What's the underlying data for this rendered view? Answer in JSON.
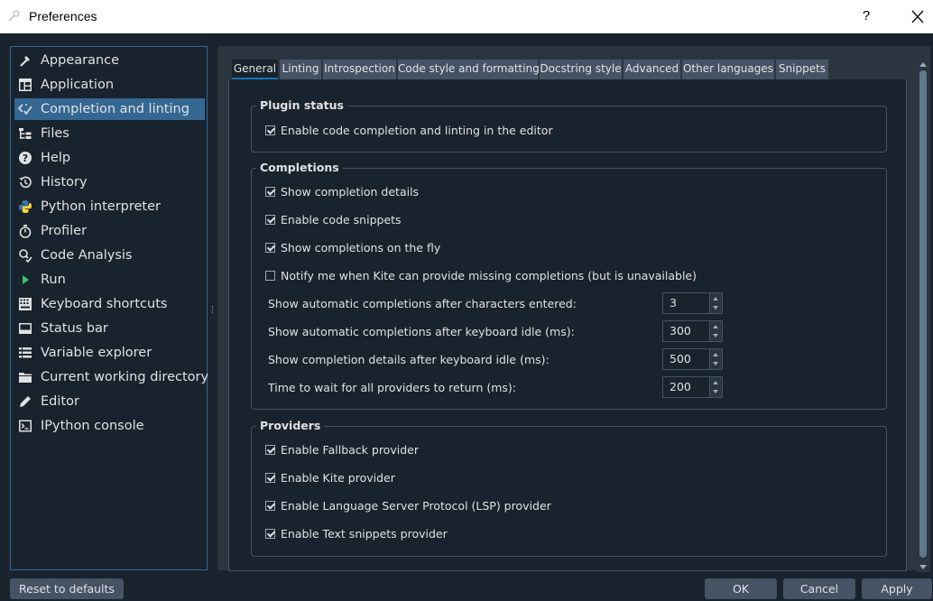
{
  "window": {
    "title": "Preferences",
    "help_label": "?"
  },
  "sidebar": {
    "items": [
      {
        "label": "Appearance",
        "icon": "brush-icon"
      },
      {
        "label": "Application",
        "icon": "application-icon"
      },
      {
        "label": "Completion and linting",
        "icon": "completion-icon"
      },
      {
        "label": "Files",
        "icon": "files-icon"
      },
      {
        "label": "Help",
        "icon": "help-icon"
      },
      {
        "label": "History",
        "icon": "history-icon"
      },
      {
        "label": "Python interpreter",
        "icon": "python-icon"
      },
      {
        "label": "Profiler",
        "icon": "stopwatch-icon"
      },
      {
        "label": "Code Analysis",
        "icon": "code-analysis-icon"
      },
      {
        "label": "Run",
        "icon": "run-icon"
      },
      {
        "label": "Keyboard shortcuts",
        "icon": "keyboard-icon"
      },
      {
        "label": "Status bar",
        "icon": "status-bar-icon"
      },
      {
        "label": "Variable explorer",
        "icon": "variable-explorer-icon"
      },
      {
        "label": "Current working directory",
        "icon": "folder-icon"
      },
      {
        "label": "Editor",
        "icon": "editor-icon"
      },
      {
        "label": "IPython console",
        "icon": "console-icon"
      }
    ],
    "selected": "Completion and linting"
  },
  "tabs": [
    {
      "label": "General"
    },
    {
      "label": "Linting"
    },
    {
      "label": "Introspection"
    },
    {
      "label": "Code style and formatting"
    },
    {
      "label": "Docstring style"
    },
    {
      "label": "Advanced"
    },
    {
      "label": "Other languages"
    },
    {
      "label": "Snippets"
    }
  ],
  "active_tab": "General",
  "plugin_status": {
    "title": "Plugin status",
    "checks": [
      {
        "label": "Enable code completion and linting in the editor",
        "checked": true
      }
    ]
  },
  "completions": {
    "title": "Completions",
    "checks": [
      {
        "label": "Show completion details",
        "checked": true
      },
      {
        "label": "Enable code snippets",
        "checked": true
      },
      {
        "label": "Show completions on the fly",
        "checked": true
      },
      {
        "label": "Notify me when Kite can provide missing completions (but is unavailable)",
        "checked": false
      }
    ],
    "spinners": [
      {
        "label": "Show automatic completions after characters entered:",
        "value": "3"
      },
      {
        "label": "Show automatic completions after keyboard idle (ms):",
        "value": "300"
      },
      {
        "label": "Show completion details after keyboard idle (ms):",
        "value": "500"
      },
      {
        "label": "Time to wait for all providers to return (ms):",
        "value": "200"
      }
    ]
  },
  "providers": {
    "title": "Providers",
    "checks": [
      {
        "label": "Enable Fallback provider",
        "checked": true
      },
      {
        "label": "Enable Kite provider",
        "checked": true
      },
      {
        "label": "Enable Language Server Protocol (LSP) provider",
        "checked": true
      },
      {
        "label": "Enable Text snippets provider",
        "checked": true
      }
    ]
  },
  "buttons": {
    "reset": "Reset to defaults",
    "ok": "OK",
    "cancel": "Cancel",
    "apply": "Apply"
  },
  "colors": {
    "background": "#19232d",
    "selection": "#346792",
    "tab_bg": "#455364",
    "accent": "#1a72bb"
  }
}
